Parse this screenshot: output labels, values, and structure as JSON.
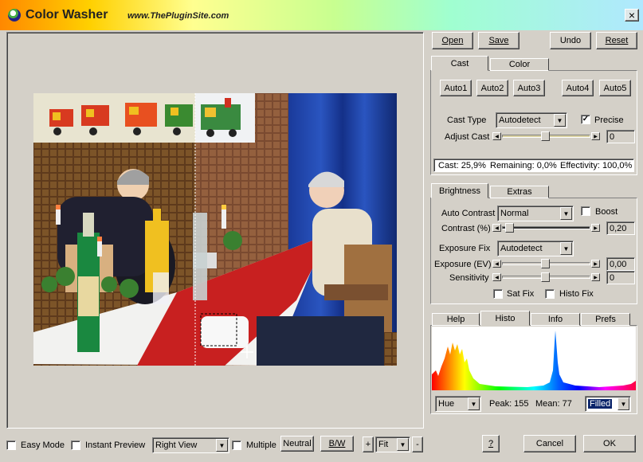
{
  "titlebar": {
    "title": "Color Washer",
    "url": "www.ThePluginSite.com",
    "close_glyph": "×",
    "gradient": [
      "#ffb000",
      "#ffff80",
      "#80ffa0",
      "#a0e0ff"
    ]
  },
  "top_buttons": {
    "open": "Open",
    "save": "Save",
    "undo": "Undo",
    "reset": "Reset"
  },
  "cast_panel": {
    "tabs": [
      "Cast",
      "Color"
    ],
    "auto_buttons": [
      "Auto1",
      "Auto2",
      "Auto3",
      "Auto4",
      "Auto5"
    ],
    "cast_type_label": "Cast Type",
    "cast_type_value": "Autodetect",
    "precise_label": "Precise",
    "precise_checked": true,
    "adjust_cast_label": "Adjust Cast",
    "adjust_cast_value": "0",
    "status_cast": "Cast: 25,9%",
    "status_remaining": "Remaining: 0,0%",
    "status_effectivity": "Effectivity: 100,0%"
  },
  "brightness_panel": {
    "tabs": [
      "Brightness",
      "Extras"
    ],
    "auto_contrast_label": "Auto Contrast",
    "auto_contrast_value": "Normal",
    "boost_label": "Boost",
    "contrast_label": "Contrast (%)",
    "contrast_value": "0,20",
    "exposure_fix_label": "Exposure Fix",
    "exposure_fix_value": "Autodetect",
    "exposure_ev_label": "Exposure (EV)",
    "exposure_ev_value": "0,00",
    "sensitivity_label": "Sensitivity",
    "sensitivity_value": "0",
    "sat_fix_label": "Sat Fix",
    "histo_fix_label": "Histo Fix"
  },
  "histo_panel": {
    "tabs": [
      "Help",
      "Histo",
      "Info",
      "Prefs"
    ],
    "mode_value": "Hue",
    "peak_text": "Peak: 155",
    "mean_text": "Mean: 77",
    "style_value": "Filled"
  },
  "bottom_bar": {
    "easy_mode": "Easy Mode",
    "instant_preview": "Instant Preview",
    "view_value": "Right View",
    "multiple": "Multiple",
    "neutral": "Neutral",
    "bw": "B/W",
    "zoom_in": "+",
    "zoom_value": "Fit",
    "zoom_out": "-",
    "help": "?",
    "cancel": "Cancel",
    "ok": "OK"
  }
}
